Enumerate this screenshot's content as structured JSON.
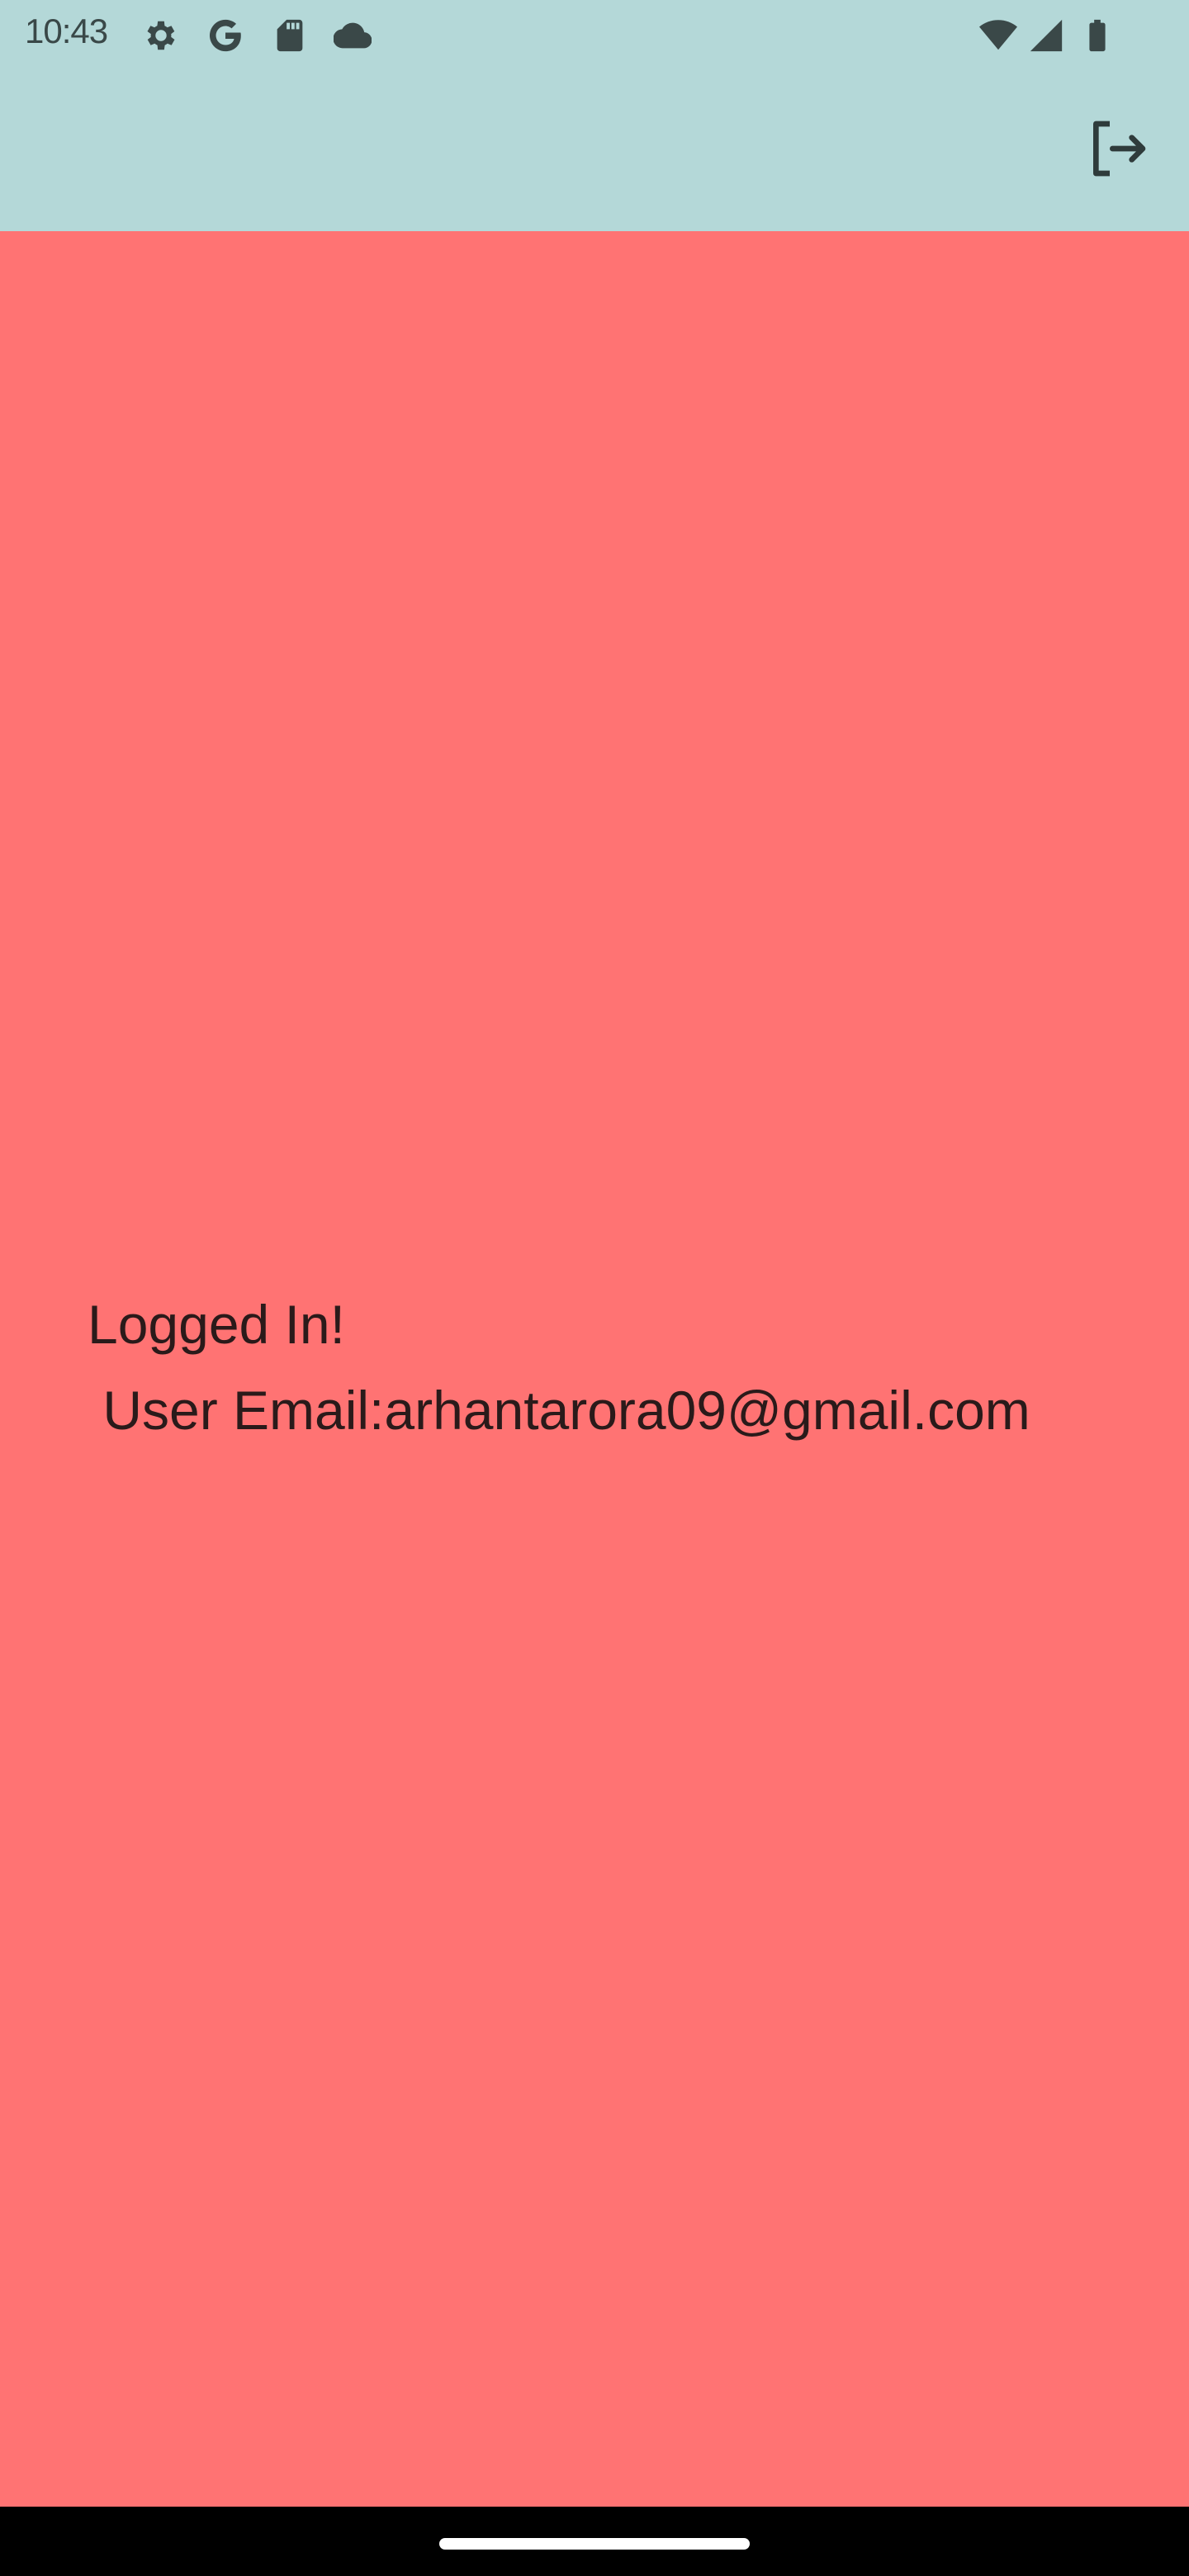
{
  "status_bar": {
    "time": "10:43",
    "icons": [
      "gear-icon",
      "google-icon",
      "sd-card-icon",
      "cloud-icon",
      "wifi-icon",
      "signal-icon",
      "battery-icon"
    ]
  },
  "app_bar": {
    "background": "#b4d8d8",
    "actions": [
      "logout-icon"
    ]
  },
  "body": {
    "background": "#ff7373",
    "message_line1": "Logged In!",
    "message_line2": " User Email:arhantarora09@gmail.com"
  },
  "nav_bar": {
    "background": "#000000"
  }
}
